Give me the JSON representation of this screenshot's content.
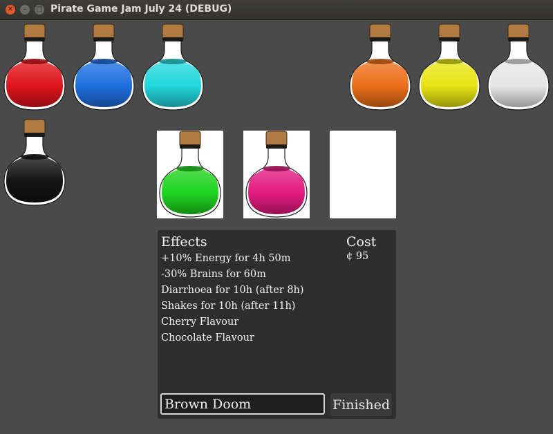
{
  "window": {
    "title": "Pirate Game Jam July 24 (DEBUG)"
  },
  "icons": {
    "close": "close-icon",
    "minimize": "minimize-icon",
    "maximize": "maximize-icon"
  },
  "potions": [
    {
      "name": "red-potion",
      "color": "#e0141c"
    },
    {
      "name": "blue-potion",
      "color": "#1f6fe0"
    },
    {
      "name": "cyan-potion",
      "color": "#22d8de"
    },
    {
      "name": "orange-potion",
      "color": "#ec6f1a"
    },
    {
      "name": "yellow-potion",
      "color": "#e8e414"
    },
    {
      "name": "white-potion",
      "color": "#e6e6e6"
    },
    {
      "name": "black-potion",
      "color": "#141414"
    }
  ],
  "mix_slots": [
    {
      "name": "green-potion",
      "color": "#1fd41f"
    },
    {
      "name": "pink-potion",
      "color": "#e41a80"
    },
    {
      "name": "empty",
      "color": null
    }
  ],
  "panel": {
    "effects_title": "Effects",
    "effects": [
      "+10% Energy for 4h 50m",
      "-30% Brains for 60m",
      "Diarrhoea for 10h (after 8h)",
      "Shakes for 10h (after 11h)",
      "Cherry Flavour",
      "Chocolate Flavour"
    ],
    "cost_title": "Cost",
    "cost_value": "¢ 95",
    "name_value": "Brown Doom",
    "finished_label": "Finished"
  }
}
